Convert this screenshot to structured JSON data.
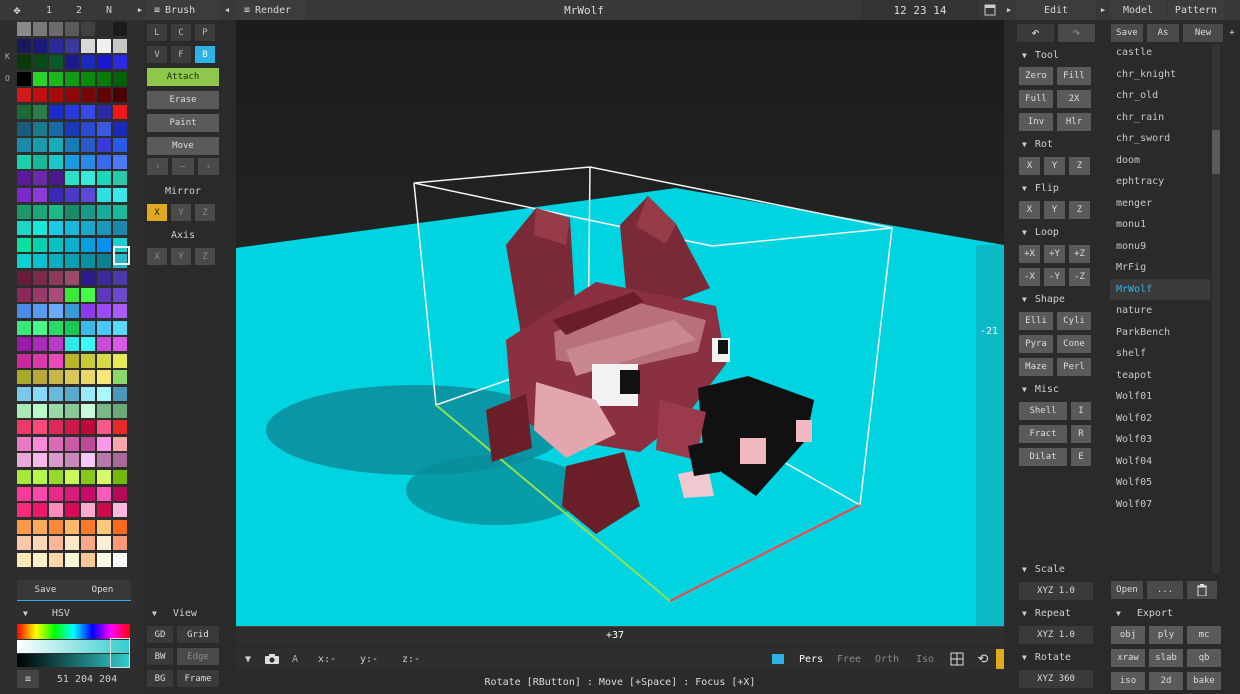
{
  "top": {
    "left_tabs": [
      "1",
      "2",
      "N"
    ],
    "brush_title": "Brush",
    "render_title": "Render",
    "model_name": "MrWolf",
    "dims": "12 23 14",
    "edit_title": "Edit",
    "model_tab": "Model",
    "pattern_tab": "Pattern"
  },
  "left_side": {
    "k": "K",
    "o": "O"
  },
  "palette": {
    "rows": [
      [
        "#8a8a8a",
        "#7a7a7a",
        "#6a6a6a",
        "#5a5a5a",
        "#404040",
        "#2a2a2a",
        "#1a1a1a"
      ],
      [
        "#1a1a5a",
        "#1a1a7a",
        "#2a2a9a",
        "#3a3a9a",
        "#d8d8d8",
        "#f0f0f0",
        "#c8c8c8"
      ],
      [
        "#0a3a0a",
        "#0a4a1a",
        "#0a5a2a",
        "#1a1a8a",
        "#1a2aba",
        "#1a1acc",
        "#2a2ae0"
      ],
      [
        "#000000",
        "#2ad22a",
        "#1ab81a",
        "#129a12",
        "#0a8a0a",
        "#087a08",
        "#066006"
      ],
      [
        "#d01a1a",
        "#c01010",
        "#a80a0a",
        "#900808",
        "#780606",
        "#600404",
        "#480202"
      ],
      [
        "#1a6a3a",
        "#2a7a4a",
        "#1a2ac8",
        "#2a3ad8",
        "#3a4ae8",
        "#2a2aa8",
        "#ee1a1a"
      ],
      [
        "#1a5a7a",
        "#1a7a8a",
        "#1a6aaa",
        "#1a3ab8",
        "#2a4ad0",
        "#3a5ae0",
        "#1a2ab8"
      ],
      [
        "#1a8aaa",
        "#1a9aaa",
        "#1aaaba",
        "#1a7ab8",
        "#2a5ac8",
        "#3a3ad8",
        "#2a5ae8"
      ],
      [
        "#1ad0a8",
        "#1ab898",
        "#1ac8c8",
        "#1a9ae0",
        "#2a8ae8",
        "#3a6af0",
        "#4a7af8"
      ],
      [
        "#5a1a9a",
        "#6a2aaa",
        "#4a1a8a",
        "#2ae0c8",
        "#3ae8d8",
        "#1ad8b8",
        "#2ac8a8"
      ],
      [
        "#7a2ac8",
        "#8a3ad8",
        "#3a2ab8",
        "#4a3ac8",
        "#5a4ad8",
        "#2ae0e0",
        "#3ae8e8"
      ],
      [
        "#1a9a6a",
        "#1aa87a",
        "#1ab88a",
        "#1a8a6a",
        "#1a9a8a",
        "#1aaa9a",
        "#1aba9a"
      ],
      [
        "#1ad8c8",
        "#1ae8d8",
        "#1ac8e8",
        "#1ab8d8",
        "#1aa8c8",
        "#1a98b8",
        "#1a88a8"
      ],
      [
        "#0ae0a0",
        "#0ad0b0",
        "#0ac0c0",
        "#0ab0d0",
        "#0aa0e0",
        "#0a90f0",
        "#20d0d0"
      ],
      [
        "#0ad0d0",
        "#0ac0d0",
        "#0ab0c0",
        "#0aa0b0",
        "#0a90a0",
        "#0a8090",
        "#2ab8c8"
      ],
      [
        "#6a1a3a",
        "#7a2a4a",
        "#8a3a5a",
        "#9a4a6a",
        "#2a1a8a",
        "#3a2a9a",
        "#4a3aaa"
      ],
      [
        "#8a2a5a",
        "#9a3a6a",
        "#aa4a7a",
        "#3ae83a",
        "#4af84a",
        "#5a3ab8",
        "#6a4ac8"
      ],
      [
        "#4a8ae8",
        "#5a9af0",
        "#6aaaf8",
        "#3a9ad8",
        "#8a3ae8",
        "#9a4af8",
        "#aa5af8"
      ],
      [
        "#3ae87a",
        "#4af88a",
        "#2ad86a",
        "#1ac85a",
        "#3ab8e8",
        "#4ac8f8",
        "#5ad8f8"
      ],
      [
        "#9a1aaa",
        "#aa2aba",
        "#ba3aca",
        "#2aeaea",
        "#3afafa",
        "#ca4ada",
        "#da5aea"
      ],
      [
        "#c82a9a",
        "#d83aaa",
        "#e84aba",
        "#b8b82a",
        "#c8c83a",
        "#d8d84a",
        "#e8e85a"
      ],
      [
        "#a8a82a",
        "#b8a83a",
        "#c8b84a",
        "#d8c85a",
        "#e8d86a",
        "#f8e87a",
        "#8ad86a"
      ],
      [
        "#7ac8ea",
        "#8ad8fa",
        "#6ab8da",
        "#5aa8ca",
        "#9ae8fa",
        "#aaf8fa",
        "#4a98ba"
      ],
      [
        "#aae8b8",
        "#baf8c8",
        "#9ad8a8",
        "#8ac898",
        "#cafad8",
        "#7ab888",
        "#6aa878"
      ],
      [
        "#ea3a6a",
        "#fa4a7a",
        "#da2a5a",
        "#ca1a4a",
        "#ba0a3a",
        "#fa5a8a",
        "#e82a2a"
      ],
      [
        "#ea7ac8",
        "#fa8ad8",
        "#da6ab8",
        "#ca5aa8",
        "#ba4a98",
        "#fa9ae8",
        "#f8a8a8"
      ],
      [
        "#e8a8d8",
        "#f8b8e8",
        "#d898c8",
        "#c888b8",
        "#f8c8f8",
        "#b878a8",
        "#a86898"
      ],
      [
        "#a8e83a",
        "#b8f84a",
        "#98d82a",
        "#c8f85a",
        "#88c81a",
        "#d8fa6a",
        "#78b80a"
      ],
      [
        "#f83a9a",
        "#fa4aaa",
        "#e82a8a",
        "#d81a7a",
        "#c80a6a",
        "#fa5aba",
        "#b80a5a"
      ],
      [
        "#fa2a7a",
        "#ea1a6a",
        "#fa8aba",
        "#da0a5a",
        "#faaad0",
        "#ca0a4a",
        "#fab8e0"
      ],
      [
        "#fa9a4a",
        "#faaa5a",
        "#fa8a3a",
        "#fab86a",
        "#fa7a2a",
        "#fac87a",
        "#fa6a1a"
      ],
      [
        "#fac8a8",
        "#fad8b8",
        "#fab898",
        "#fae8c8",
        "#faa888",
        "#faf0d8",
        "#fa9878"
      ],
      [
        "#fae8b8",
        "#faf0c8",
        "#fad8a8",
        "#faf8d8",
        "#fac898",
        "#fafae8",
        "#f8f8f8"
      ]
    ]
  },
  "left_bottom": {
    "save": "Save",
    "open": "Open",
    "hsv": "HSV",
    "rgb_text": "51 204 204",
    "menu_glyph": "≡"
  },
  "brush": {
    "modes": [
      "L",
      "C",
      "P",
      "V",
      "F",
      "B"
    ],
    "actions": [
      "Attach",
      "Erase",
      "Paint",
      "Move"
    ],
    "arrows": [
      "‹",
      "–",
      "›"
    ],
    "mirror_title": "Mirror",
    "mirror_axes": [
      "X",
      "Y",
      "Z"
    ],
    "axis_title": "Axis",
    "axis_axes": [
      "X",
      "Y",
      "Z"
    ],
    "view_title": "View",
    "view_buttons": [
      [
        "GD",
        "Grid"
      ],
      [
        "BW",
        "Edge"
      ],
      [
        "BG",
        "Frame"
      ]
    ]
  },
  "viewport": {
    "label_right": "-21",
    "label_bottom": "+37",
    "bg_floor": "#00d4e0",
    "bg_sky": "#262626"
  },
  "bottom_bar": {
    "a_label": "A",
    "x_label": "x:-",
    "y_label": "y:-",
    "z_label": "z:-",
    "modes": [
      "Pers",
      "Free",
      "Orth",
      "Iso"
    ],
    "status": "Rotate [RButton] : Move [+Space] : Focus [+X]"
  },
  "edit": {
    "undo_icon": "↶",
    "redo_icon": "↷",
    "tool_title": "Tool",
    "tool_buttons": [
      [
        "Zero",
        "Fill"
      ],
      [
        "Full",
        "2X"
      ],
      [
        "Inv",
        "Hlr"
      ]
    ],
    "rot_title": "Rot",
    "rot_axes": [
      "X",
      "Y",
      "Z"
    ],
    "flip_title": "Flip",
    "flip_axes": [
      "X",
      "Y",
      "Z"
    ],
    "loop_title": "Loop",
    "loop_buttons": [
      [
        "+X",
        "+Y",
        "+Z"
      ],
      [
        "-X",
        "-Y",
        "-Z"
      ]
    ],
    "shape_title": "Shape",
    "shape_buttons": [
      [
        "Elli",
        "Cyli"
      ],
      [
        "Pyra",
        "Cone"
      ],
      [
        "Maze",
        "Perl"
      ]
    ],
    "misc_title": "Misc",
    "misc_buttons": [
      [
        "Shell",
        "I"
      ],
      [
        "Fract",
        "R"
      ],
      [
        "Dilat",
        "E"
      ]
    ],
    "scale_title": "Scale",
    "scale_value": "XYZ 1.0",
    "repeat_title": "Repeat",
    "repeat_value": "XYZ 1.0",
    "rotate_title": "Rotate",
    "rotate_value": "XYZ 360"
  },
  "model": {
    "save": "Save",
    "as": "As",
    "new": "New",
    "plus": "+",
    "items": [
      "castle",
      "chr_knight",
      "chr_old",
      "chr_rain",
      "chr_sword",
      "doom",
      "ephtracy",
      "menger",
      "monu1",
      "monu9",
      "MrFig",
      "MrWolf",
      "nature",
      "ParkBench",
      "shelf",
      "teapot",
      "Wolf01",
      "Wolf02",
      "Wolf03",
      "Wolf04",
      "Wolf05",
      "Wolf07"
    ],
    "active": "MrWolf",
    "open": "Open",
    "dots": "...",
    "export_title": "Export",
    "export_buttons": [
      [
        "obj",
        "ply",
        "mc"
      ],
      [
        "xraw",
        "slab",
        "qb"
      ],
      [
        "iso",
        "2d",
        "bake"
      ]
    ]
  }
}
